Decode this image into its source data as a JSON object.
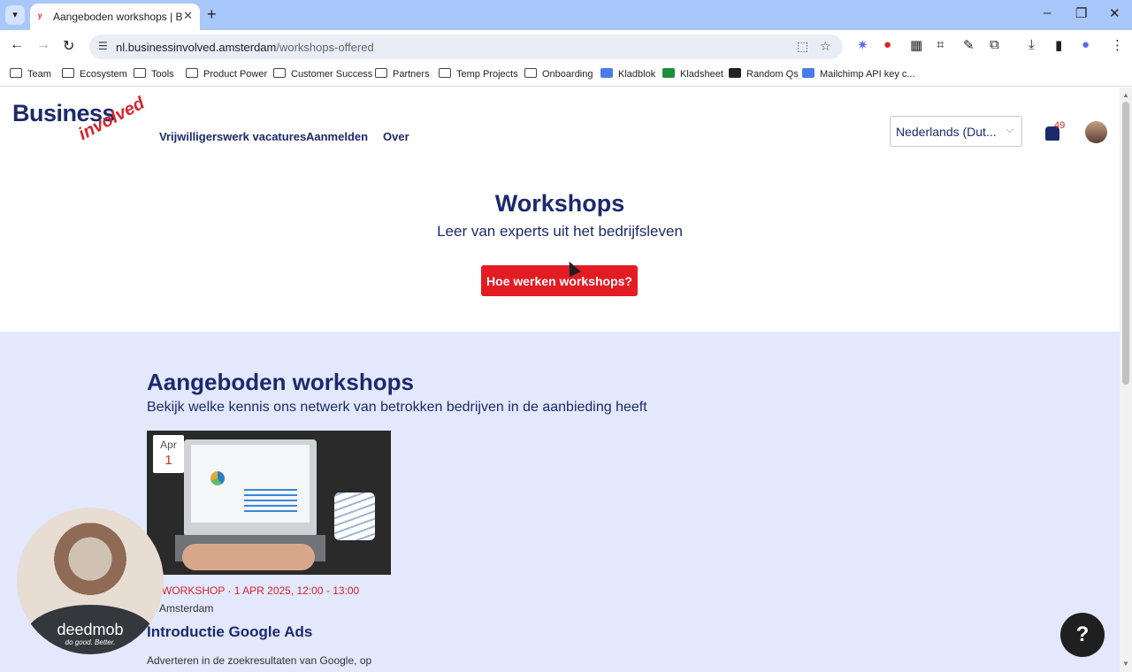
{
  "browser": {
    "tab": {
      "title": "Aangeboden workshops | Business Involved",
      "close_glyph": "✕"
    },
    "new_tab_glyph": "+",
    "window": {
      "minimize": "–",
      "restore": "❐",
      "close": "✕"
    },
    "nav": {
      "back": "←",
      "forward": "→",
      "reload": "↻"
    },
    "url": {
      "host": "nl.businessinvolved.amsterdam",
      "path": "/workshops-offered"
    },
    "bookmarks": [
      {
        "label": "Team",
        "icon": "folder-icon"
      },
      {
        "label": "Ecosystem",
        "icon": "folder-icon"
      },
      {
        "label": "Tools",
        "icon": "folder-icon"
      },
      {
        "label": "Product Power",
        "icon": "folder-icon"
      },
      {
        "label": "Customer Success",
        "icon": "folder-icon"
      },
      {
        "label": "Partners",
        "icon": "folder-icon"
      },
      {
        "label": "Temp Projects",
        "icon": "folder-icon"
      },
      {
        "label": "Onboarding",
        "icon": "folder-icon"
      },
      {
        "label": "Kladblok",
        "icon": "doc-icon"
      },
      {
        "label": "Kladsheet",
        "icon": "sheet-icon"
      },
      {
        "label": "Random Qs",
        "icon": "w-icon"
      },
      {
        "label": "Mailchimp API key c...",
        "icon": "doc-icon"
      }
    ]
  },
  "site": {
    "logo": {
      "word1": "Business",
      "word2": "involved"
    },
    "nav": [
      "Vrijwilligerswerk vacatures",
      "Aanmelden",
      "Over"
    ],
    "language": "Nederlands (Dut...",
    "notifications": "49",
    "colors": {
      "primary": "#1c2a6b",
      "accent": "#e31b23",
      "section_bg": "#e3e8fd"
    }
  },
  "hero": {
    "title": "Workshops",
    "subtitle": "Leer van experts uit het bedrijfsleven",
    "button": "Hoe werken workshops?"
  },
  "section": {
    "title": "Aangeboden workshops",
    "subtitle": "Bekijk welke kennis ons netwerk van betrokken bedrijven in de aanbieding heeft"
  },
  "card": {
    "date_month": "Apr",
    "date_day": "1",
    "meta": "WORKSHOP · 1 APR 2025, 12:00 - 13:00",
    "city": "Amsterdam",
    "title": "Introductie Google Ads",
    "description": "Adverteren in de zoekresultaten van Google, op"
  },
  "help_button": "?",
  "webcam": {
    "brand": "deedmob",
    "tagline": "do good. Better."
  }
}
